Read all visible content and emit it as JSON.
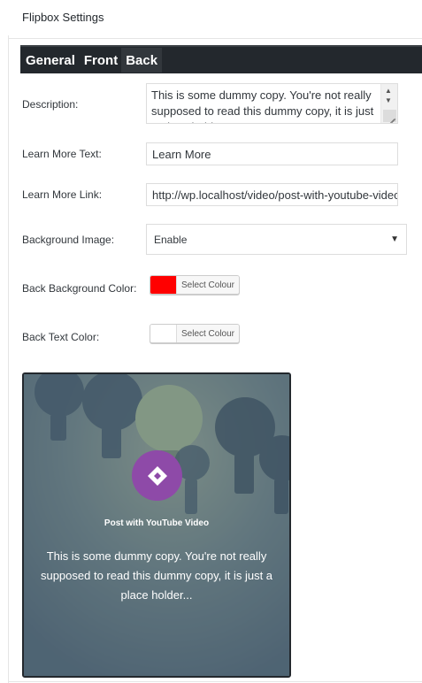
{
  "panel": {
    "title": "Flipbox Settings"
  },
  "tabs": [
    {
      "label": "General"
    },
    {
      "label": "Front"
    },
    {
      "label": "Back",
      "active": true
    }
  ],
  "fields": {
    "description": {
      "label": "Description:",
      "value": "This is some dummy copy. You're not really supposed to read this dummy copy, it is just a place holder..."
    },
    "learn_more_text": {
      "label": "Learn More Text:",
      "value": "Learn More"
    },
    "learn_more_link": {
      "label": "Learn More Link:",
      "value": "http://wp.localhost/video/post-with-youtube-video"
    },
    "background_image": {
      "label": "Background Image:",
      "selected": "Enable"
    },
    "back_bg_color": {
      "label": "Back Background Color:",
      "button_label": "Select Colour",
      "color": "#ff0000"
    },
    "back_text_color": {
      "label": "Back Text Color:",
      "button_label": "Select Colour",
      "color": "#ffffff"
    }
  },
  "preview": {
    "post_title": "Post with YouTube Video",
    "description": "This is some dummy copy. You're not really supposed to read this dummy copy, it is just a place holder...",
    "badge_color": "#8e4aa8",
    "badge_icon": "diamond-icon"
  }
}
